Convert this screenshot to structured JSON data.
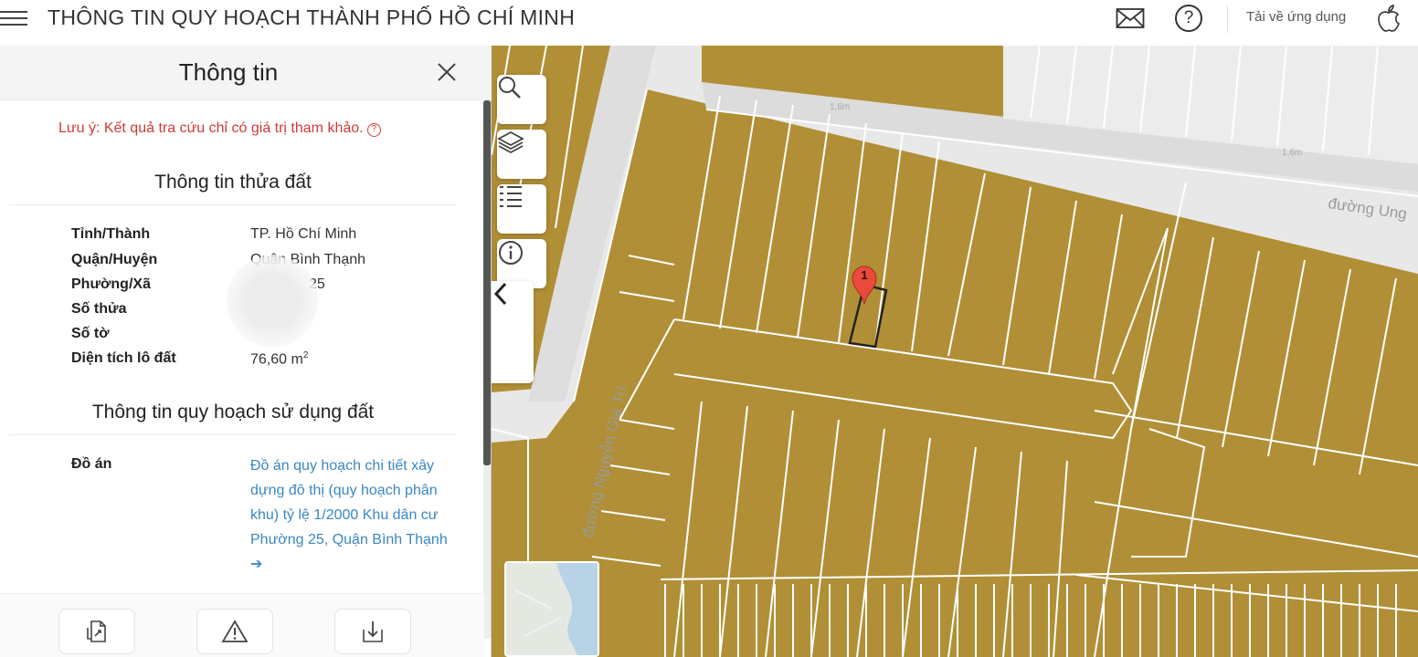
{
  "app": {
    "title": "THÔNG TIN QUY HOẠCH THÀNH PHỐ HỒ CHÍ MINH",
    "download_app": "Tải về ứng dụng",
    "icons": [
      "menu-icon",
      "mail-icon",
      "help-icon",
      "apple-icon"
    ]
  },
  "panel": {
    "title": "Thông tin",
    "note": "Lưu ý: Kết quả tra cứu chỉ có giá trị tham khảo.",
    "note_color": "#d23a3a",
    "land_section_title": "Thông tin thửa đất",
    "land_info": [
      {
        "label": "Tỉnh/Thành",
        "value": "TP. Hồ Chí Minh"
      },
      {
        "label": "Quận/Huyện",
        "value": "Quận Bình Thạnh"
      },
      {
        "label": "Phường/Xã",
        "value": "25"
      },
      {
        "label": "Số thửa",
        "value": ""
      },
      {
        "label": "Số tờ",
        "value": ""
      },
      {
        "label": "Diện tích lô đất",
        "value": "76,60 m",
        "unit_sup": "2"
      }
    ],
    "planning_section_title": "Thông tin quy hoạch sử dụng đất",
    "planning": {
      "label": "Đồ án",
      "link_text": "Đồ án quy hoạch chi tiết xây dựng đô thị (quy hoạch phân khu) tỷ lệ 1/2000 Khu dân cư Phường 25, Quận Bình Thạnh",
      "link_color": "#3b87c4"
    },
    "footer_buttons": [
      "document-icon",
      "warning-icon",
      "download-icon"
    ]
  },
  "map": {
    "tools": [
      "search-icon",
      "layers-icon",
      "list-icon",
      "info-icon"
    ],
    "collapse": "chevron-left-icon",
    "street_labels": [
      "đường Nguyễn Gia Trí",
      "đường Ung"
    ],
    "width_labels": [
      "1,6m",
      "1,6m"
    ],
    "marker_label": "1",
    "parcel_color": "#b18f36",
    "road_color": "#e8e8e8"
  }
}
